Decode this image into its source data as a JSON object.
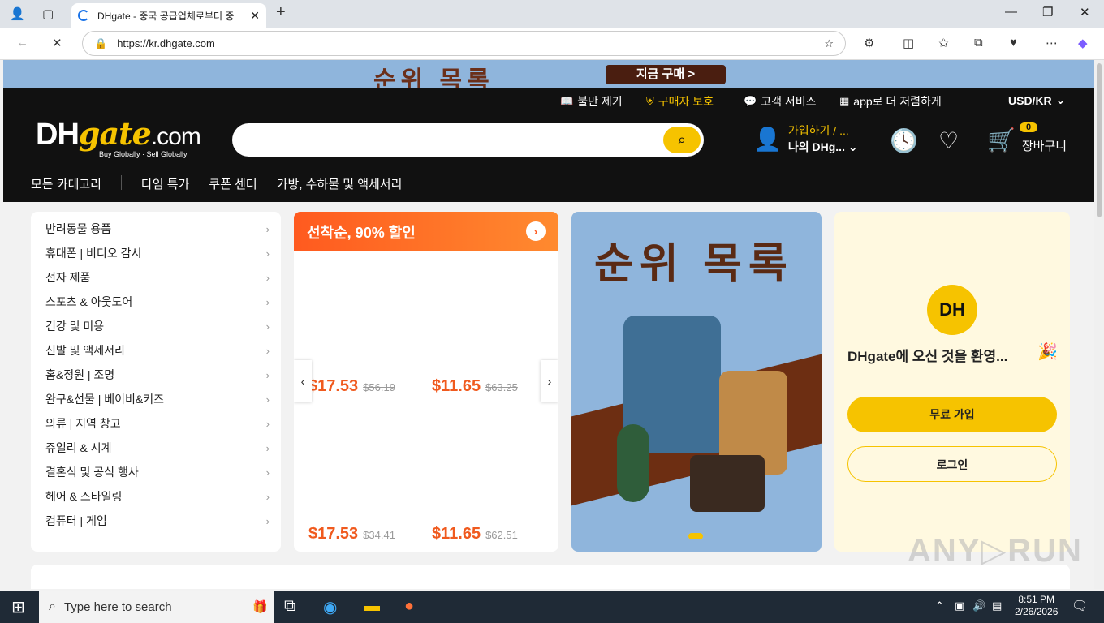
{
  "browser": {
    "tab_title": "DHgate - 중국 공급업체로부터 중",
    "url": "https://kr.dhgate.com"
  },
  "promo": {
    "headline": "순위 목록",
    "buy_button": "지금 구매 >"
  },
  "utility_links": [
    "불만 제기",
    "구매자 보호",
    "고객 서비스",
    "app로 더 저렴하게",
    "USD/KR"
  ],
  "logo": {
    "dh": "DH",
    "gate": "gate",
    "com": ".com",
    "tagline": "Buy Globally · Sell Globally"
  },
  "account": {
    "line1": "가입하기 / ...",
    "line2": "나의 DHg..."
  },
  "cart": {
    "count": "0",
    "label": "장바구니"
  },
  "nav": {
    "all_categories": "모든 카테고리",
    "items": [
      "타임 특가",
      "쿠폰 센터",
      "가방, 수하물 및 액세서리"
    ]
  },
  "categories": [
    "반려동물 용품",
    "휴대폰 | 비디오 감시",
    "전자 제품",
    "스포츠 & 아웃도어",
    "건강 및 미용",
    "신발 및 액세서리",
    "홈&정원 | 조명",
    "완구&선물 | 베이비&키즈",
    "의류 | 지역 창고",
    "쥬얼리 & 시계",
    "결혼식 및 공식 행사",
    "헤어 & 스타일링",
    "컴퓨터 | 게임"
  ],
  "flash_sale": {
    "title": "선착순, 90% 할인",
    "prices": [
      {
        "now": "$17.53",
        "old": "$56.19"
      },
      {
        "now": "$11.65",
        "old": "$63.25"
      },
      {
        "now": "$17.53",
        "old": "$34.41"
      },
      {
        "now": "$11.65",
        "old": "$62.51"
      }
    ]
  },
  "banner": {
    "title": "순위 목록"
  },
  "welcome": {
    "title": "DHgate에 오신 것을 환영...",
    "join": "무료 가입",
    "login": "로그인",
    "avatar": "DH"
  },
  "taskbar": {
    "search_placeholder": "Type here to search",
    "time": "8:51 PM",
    "date": "2/26/2026"
  }
}
